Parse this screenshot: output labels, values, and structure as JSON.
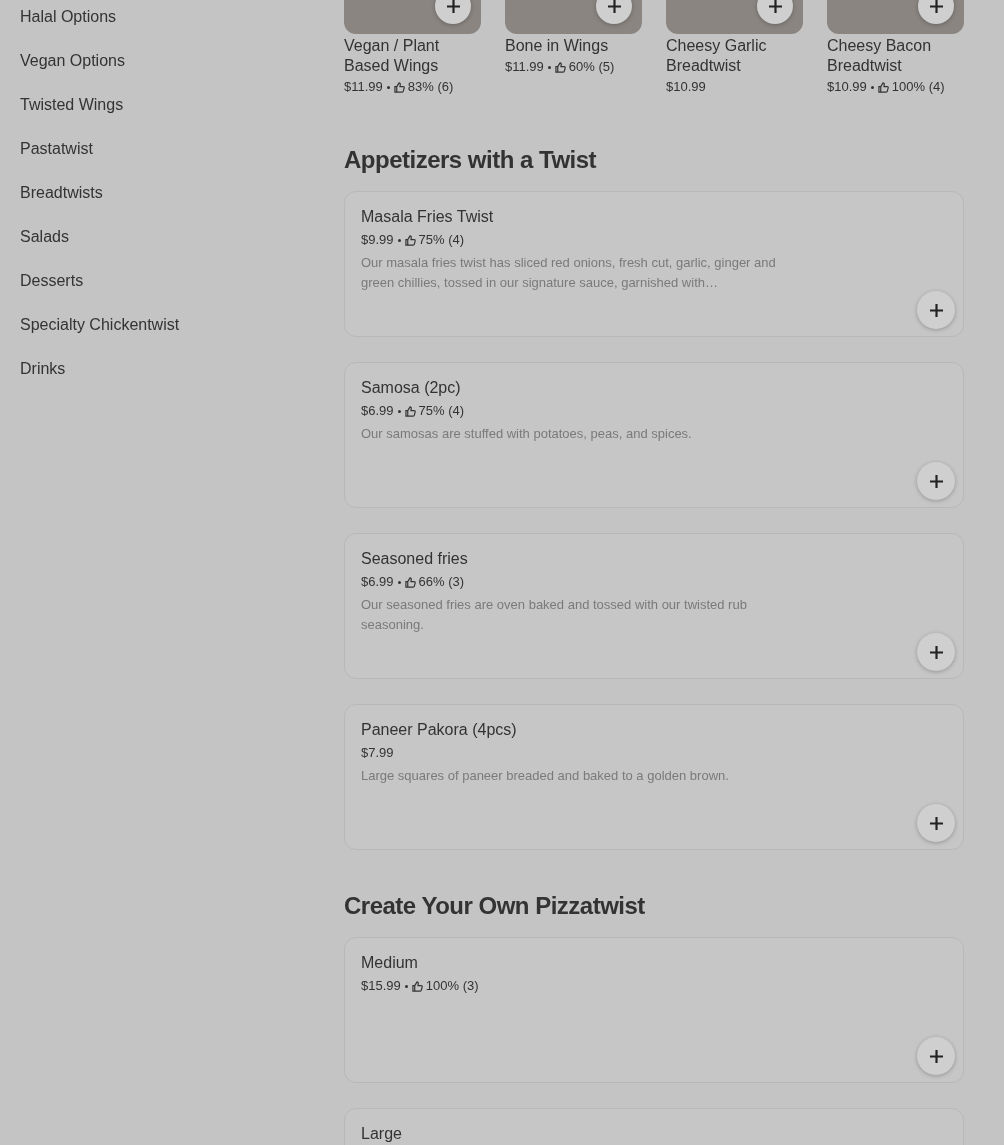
{
  "sidebar": {
    "items": [
      {
        "label": "Halal Options"
      },
      {
        "label": "Vegan Options"
      },
      {
        "label": "Twisted Wings"
      },
      {
        "label": "Pastatwist"
      },
      {
        "label": "Breadtwists"
      },
      {
        "label": "Salads"
      },
      {
        "label": "Desserts"
      },
      {
        "label": "Specialty Chickentwist"
      },
      {
        "label": "Drinks"
      }
    ]
  },
  "featured_items": [
    {
      "name": "Vegan / Plant Based Wings",
      "price": "$11.99",
      "rating": "83% (6)"
    },
    {
      "name": "Bone in Wings",
      "price": "$11.99",
      "rating": "60% (5)"
    },
    {
      "name": "Cheesy Garlic Breadtwist",
      "price": "$10.99"
    },
    {
      "name": "Cheesy Bacon Breadtwist",
      "price": "$10.99",
      "rating": "100% (4)"
    }
  ],
  "sections": [
    {
      "title": "Appetizers with a Twist",
      "items": [
        {
          "name": "Masala Fries Twist",
          "price": "$9.99",
          "rating": "75% (4)",
          "description": "Our masala fries twist has sliced red onions, fresh cut, garlic, ginger and green chillies, tossed in our signature sauce, garnished with…"
        },
        {
          "name": "Samosa (2pc)",
          "price": "$6.99",
          "rating": "75% (4)",
          "description": "Our samosas are stuffed with potatoes, peas, and spices."
        },
        {
          "name": "Seasoned fries",
          "price": "$6.99",
          "rating": "66% (3)",
          "description": "Our seasoned fries are oven baked and tossed with our twisted rub seasoning."
        },
        {
          "name": "Paneer Pakora (4pcs)",
          "price": "$7.99",
          "description": "Large squares of paneer breaded and baked to a golden brown."
        }
      ]
    },
    {
      "title": "Create Your Own Pizzatwist",
      "items": [
        {
          "name": "Medium",
          "price": "$15.99",
          "rating": "100% (3)"
        },
        {
          "name": "Large"
        }
      ]
    }
  ]
}
